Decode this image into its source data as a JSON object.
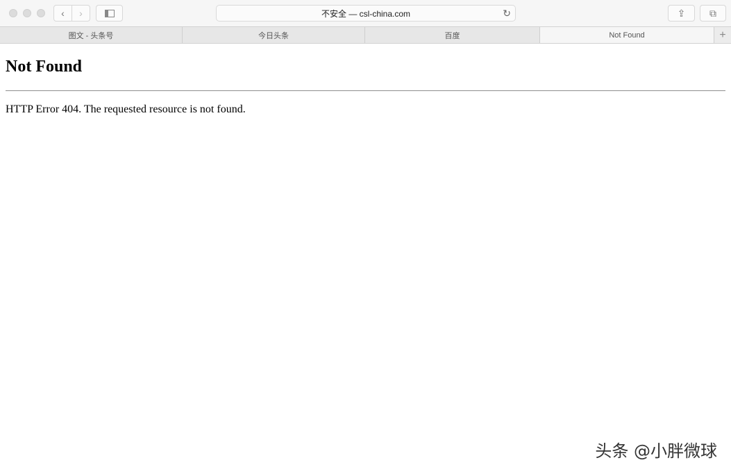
{
  "browser": {
    "address": "不安全 — csl-china.com",
    "tabs": [
      {
        "label": "图文 - 头条号"
      },
      {
        "label": "今日头条"
      },
      {
        "label": "百度"
      },
      {
        "label": "Not Found",
        "active": true
      }
    ],
    "icons": [
      "back-icon",
      "forward-icon",
      "sidebar-icon",
      "reload-icon",
      "share-icon",
      "tabs-overview-icon",
      "new-tab-icon"
    ]
  },
  "page": {
    "heading": "Not Found",
    "message": "HTTP Error 404. The requested resource is not found."
  },
  "watermark": "头条 @小胖微球"
}
